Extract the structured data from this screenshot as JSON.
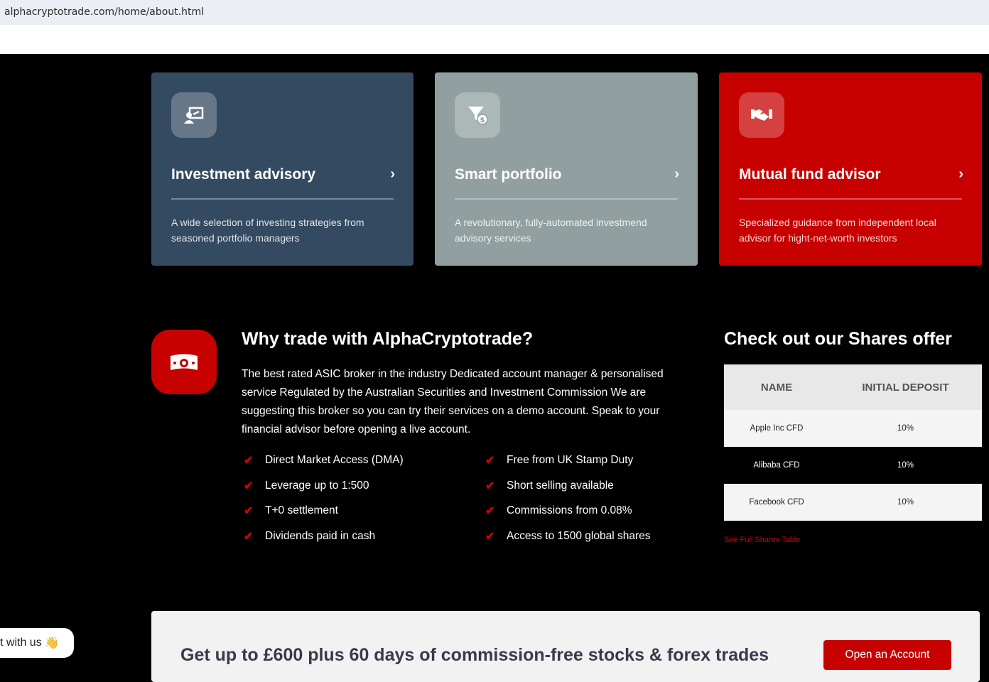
{
  "browser": {
    "url": "alphacryptotrade.com/home/about.html"
  },
  "cards": [
    {
      "title": "Investment advisory",
      "desc": "A wide selection of investing strategies from seasoned portfolio managers",
      "bg": "#344a60"
    },
    {
      "title": "Smart portfolio",
      "desc": "A revolutionary, fully-automated investmend advisory services",
      "bg": "#919fa0"
    },
    {
      "title": "Mutual fund advisor",
      "desc": "Specialized guidance from independent local advisor for hight-net-worth investors",
      "bg": "#c70000"
    }
  ],
  "why": {
    "title": "Why trade with AlphaCryptotrade?",
    "text": "The best rated ASIC broker in the industry Dedicated account manager & personalised service Regulated by the Australian Securities and Investment Commission We are suggesting this broker so you can try their services on a demo account. Speak to your financial advisor before opening a live account.",
    "features_left": [
      "Direct Market Access (DMA)",
      "Leverage up to 1:500",
      "T+0 settlement",
      "Dividends paid in cash"
    ],
    "features_right": [
      "Free from UK Stamp Duty",
      "Short selling available",
      "Commissions from 0.08%",
      "Access to 1500 global shares"
    ]
  },
  "shares": {
    "title": "Check out our Shares offer",
    "headers": [
      "NAME",
      "INITIAL DEPOSIT"
    ],
    "rows": [
      [
        "Apple Inc CFD",
        "10%"
      ],
      [
        "Alibaba CFD",
        "10%"
      ],
      [
        "Facebook CFD",
        "10%"
      ]
    ],
    "link": "See Full Shares Table"
  },
  "promo": {
    "text": "Get up to £600 plus 60 days of commission-free stocks & forex trades",
    "button": "Open an Account"
  },
  "chat": {
    "label": "t with us",
    "emoji": "👋"
  },
  "colors": {
    "accent": "#c70000",
    "background": "#000000"
  }
}
